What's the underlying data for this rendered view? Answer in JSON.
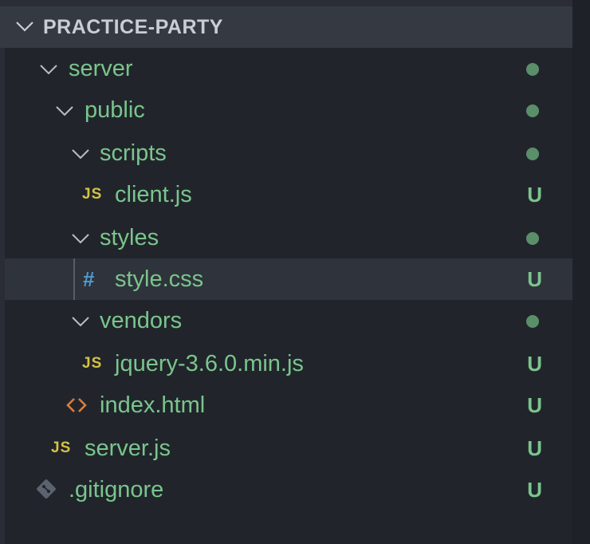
{
  "explorer": {
    "section_title": "PRACTICE-PARTY",
    "rows": [
      {
        "label": "server",
        "kind": "folder",
        "status": "dot"
      },
      {
        "label": "public",
        "kind": "folder",
        "status": "dot"
      },
      {
        "label": "scripts",
        "kind": "folder",
        "status": "dot"
      },
      {
        "label": "client.js",
        "kind": "js-file",
        "icon_text": "JS",
        "badge": "U"
      },
      {
        "label": "styles",
        "kind": "folder",
        "status": "dot"
      },
      {
        "label": "style.css",
        "kind": "css-file",
        "icon_text": "#",
        "badge": "U",
        "selected": true
      },
      {
        "label": "vendors",
        "kind": "folder",
        "status": "dot"
      },
      {
        "label": "jquery-3.6.0.min.js",
        "kind": "js-file",
        "icon_text": "JS",
        "badge": "U"
      },
      {
        "label": "index.html",
        "kind": "html-file",
        "badge": "U"
      },
      {
        "label": "server.js",
        "kind": "js-file",
        "icon_text": "JS",
        "badge": "U"
      },
      {
        "label": ".gitignore",
        "kind": "git-file",
        "badge": "U"
      }
    ]
  },
  "colors": {
    "header_bg": "#353942",
    "tree_bg": "#21252b",
    "label_green": "#7ac58d",
    "js_yellow": "#d4c245",
    "css_blue": "#4f9bd1",
    "html_orange": "#e07b39"
  }
}
